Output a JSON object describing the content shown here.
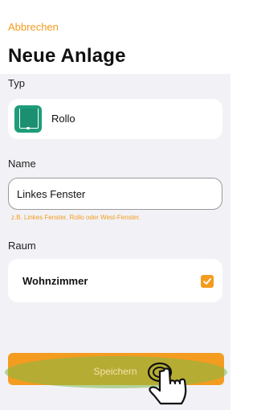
{
  "header": {
    "cancel_label": "Abbrechen",
    "title": "Neue Anlage"
  },
  "type_section": {
    "label": "Typ",
    "selected_type": "Rollo",
    "icon": "roller-shutter-icon",
    "icon_color": "#1e9d7b"
  },
  "name_section": {
    "label": "Name",
    "value": "Linkes Fenster",
    "hint": "z.B. Linkes Fenster, Rollo oder West-Fenster."
  },
  "room_section": {
    "label": "Raum",
    "room_name": "Wohnzimmer",
    "checked": true
  },
  "footer": {
    "save_label": "Speichern",
    "tap_indicator_icon": "hand-pointer-icon"
  },
  "colors": {
    "accent": "#f39c1f",
    "background": "#f2f2f6",
    "highlight": "#82b946"
  }
}
